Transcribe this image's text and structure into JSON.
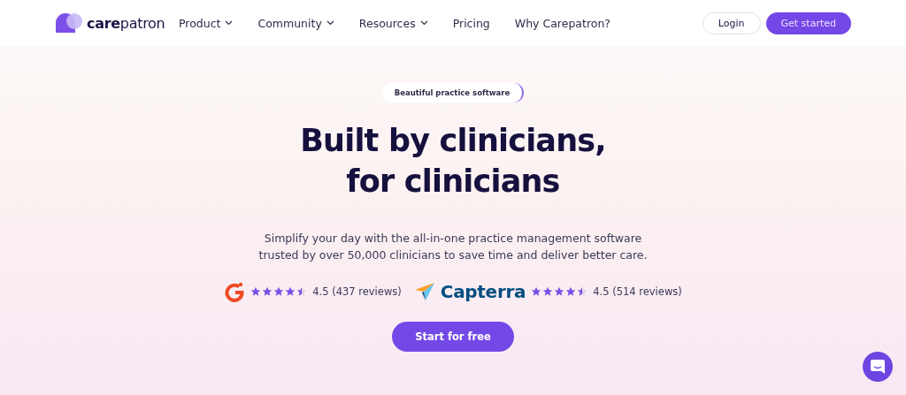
{
  "logo": {
    "text": "**care**patron"
  },
  "nav": [
    {
      "label": "Product",
      "dropdown": true
    },
    {
      "label": "Community",
      "dropdown": true
    },
    {
      "label": "Resources",
      "dropdown": true
    },
    {
      "label": "Pricing",
      "dropdown": false
    },
    {
      "label": "Why Carepatron?",
      "dropdown": false
    }
  ],
  "login": "Login",
  "get_started": "Get started",
  "badge": "Beautiful practice software",
  "headline": [
    "Built by clinicians,",
    "for clinicians"
  ],
  "subtitle": [
    "Simplify your day with the all-in-one practice management software",
    "trusted by over 50,000 clinicians to save time and deliver better care."
  ],
  "ratings": [
    {
      "kind": "g2",
      "stars": 4.5,
      "text": "4.5 (437 reviews)"
    },
    {
      "kind": "capterra",
      "brand": "Capterra",
      "stars": 4.5,
      "text": "4.5 (514 reviews)"
    }
  ],
  "cta": "Start for free"
}
